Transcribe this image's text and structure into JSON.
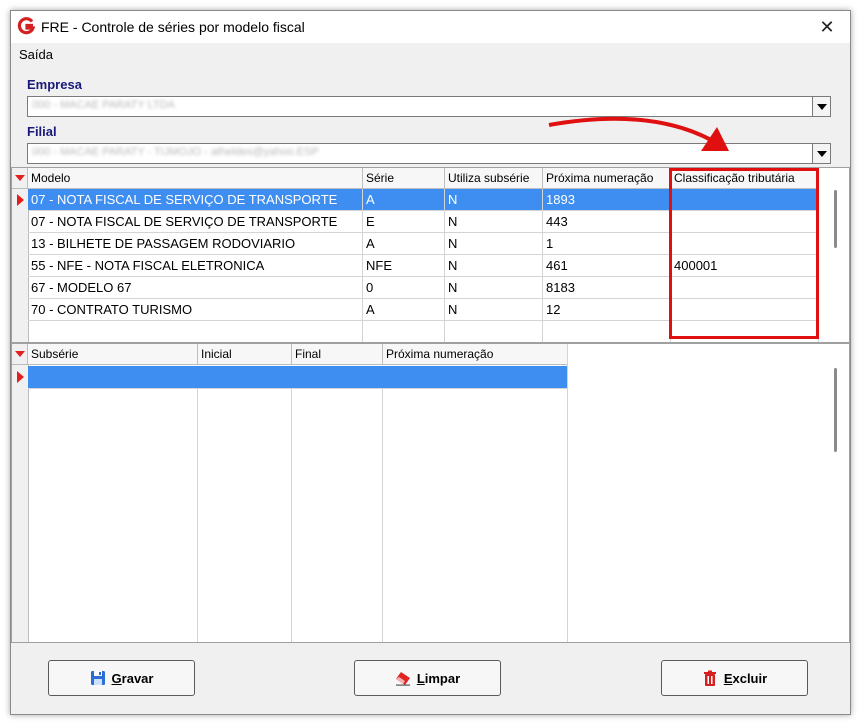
{
  "window": {
    "title": "FRE - Controle de séries por modelo fiscal",
    "close_glyph": "✕"
  },
  "menu": {
    "items": [
      {
        "label": "Saída"
      }
    ]
  },
  "empresa": {
    "label": "Empresa",
    "value": "000 - MACAE PARATY LTDA"
  },
  "filial": {
    "label": "Filial",
    "value": "000 - MACAE PARATY - TIJMOJO - atheldes@yahoo.ESP"
  },
  "series_grid": {
    "columns": [
      "Modelo",
      "Série",
      "Utiliza subsérie",
      "Próxima numeração",
      "Classificação tributária"
    ],
    "rows": [
      {
        "modelo": "07 - NOTA FISCAL DE SERVIÇO DE TRANSPORTE",
        "serie": "A",
        "utiliza": "N",
        "proxima": "1893",
        "classificacao": ""
      },
      {
        "modelo": "07 - NOTA FISCAL DE SERVIÇO DE TRANSPORTE",
        "serie": "E",
        "utiliza": "N",
        "proxima": "443",
        "classificacao": ""
      },
      {
        "modelo": "13 - BILHETE DE PASSAGEM RODOVIARIO",
        "serie": "A",
        "utiliza": "N",
        "proxima": "1",
        "classificacao": ""
      },
      {
        "modelo": "55 - NFE - NOTA FISCAL ELETRONICA",
        "serie": "NFE",
        "utiliza": "N",
        "proxima": "461",
        "classificacao": "400001"
      },
      {
        "modelo": "67 - MODELO 67",
        "serie": "0",
        "utiliza": "N",
        "proxima": "8183",
        "classificacao": ""
      },
      {
        "modelo": "70 - CONTRATO TURISMO",
        "serie": "A",
        "utiliza": "N",
        "proxima": "12",
        "classificacao": ""
      }
    ]
  },
  "subseries_grid": {
    "columns": [
      "Subsérie",
      "Inicial",
      "Final",
      "Próxima numeração"
    ]
  },
  "buttons": {
    "gravar": "Gravar",
    "limpar": "Limpar",
    "excluir": "Excluir"
  },
  "colors": {
    "selection": "#3d8ef0",
    "annotation": "#e01010",
    "label": "#1a1a7a"
  }
}
